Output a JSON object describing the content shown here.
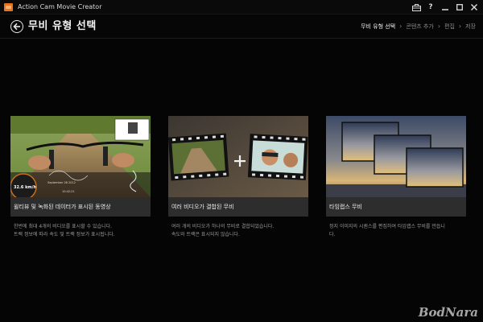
{
  "window": {
    "title": "Action Cam Movie Creator",
    "icons": [
      "app-icon",
      "toolbox-icon",
      "help-icon",
      "minimize-icon",
      "maximize-icon",
      "close-icon"
    ]
  },
  "header": {
    "title": "무비 유형 선택",
    "steps": [
      {
        "label": "무비 유형 선택",
        "active": true
      },
      {
        "label": "콘텐츠 추가",
        "active": false
      },
      {
        "label": "편집",
        "active": false
      },
      {
        "label": "저장",
        "active": false
      }
    ]
  },
  "cards": [
    {
      "title": "윌티뷰 및 녹화된 데이터가 표시된 동영상",
      "desc": [
        "한번에 최대 4개의 비디오를 표시할 수 있습니다.",
        "트랙 정보에 따라 속도 및 트랙 정보가 표시됩니다."
      ],
      "hud": {
        "speed": "32.6 km/h",
        "date": "September 28 2012",
        "time": "10:42:21"
      }
    },
    {
      "title": "여러 비디오가 결합된 무비",
      "desc": [
        "여러 개의 비디오가 하나의 무비로 결합되었습니다.",
        "속도와 트랙은 표시되지 않습니다."
      ]
    },
    {
      "title": "타임랩스 무비",
      "desc": [
        "정지 이미지의 시퀀스를 편집하여 타임랩스 무비를 만듭니",
        "다."
      ]
    }
  ],
  "watermark": "BodNara"
}
